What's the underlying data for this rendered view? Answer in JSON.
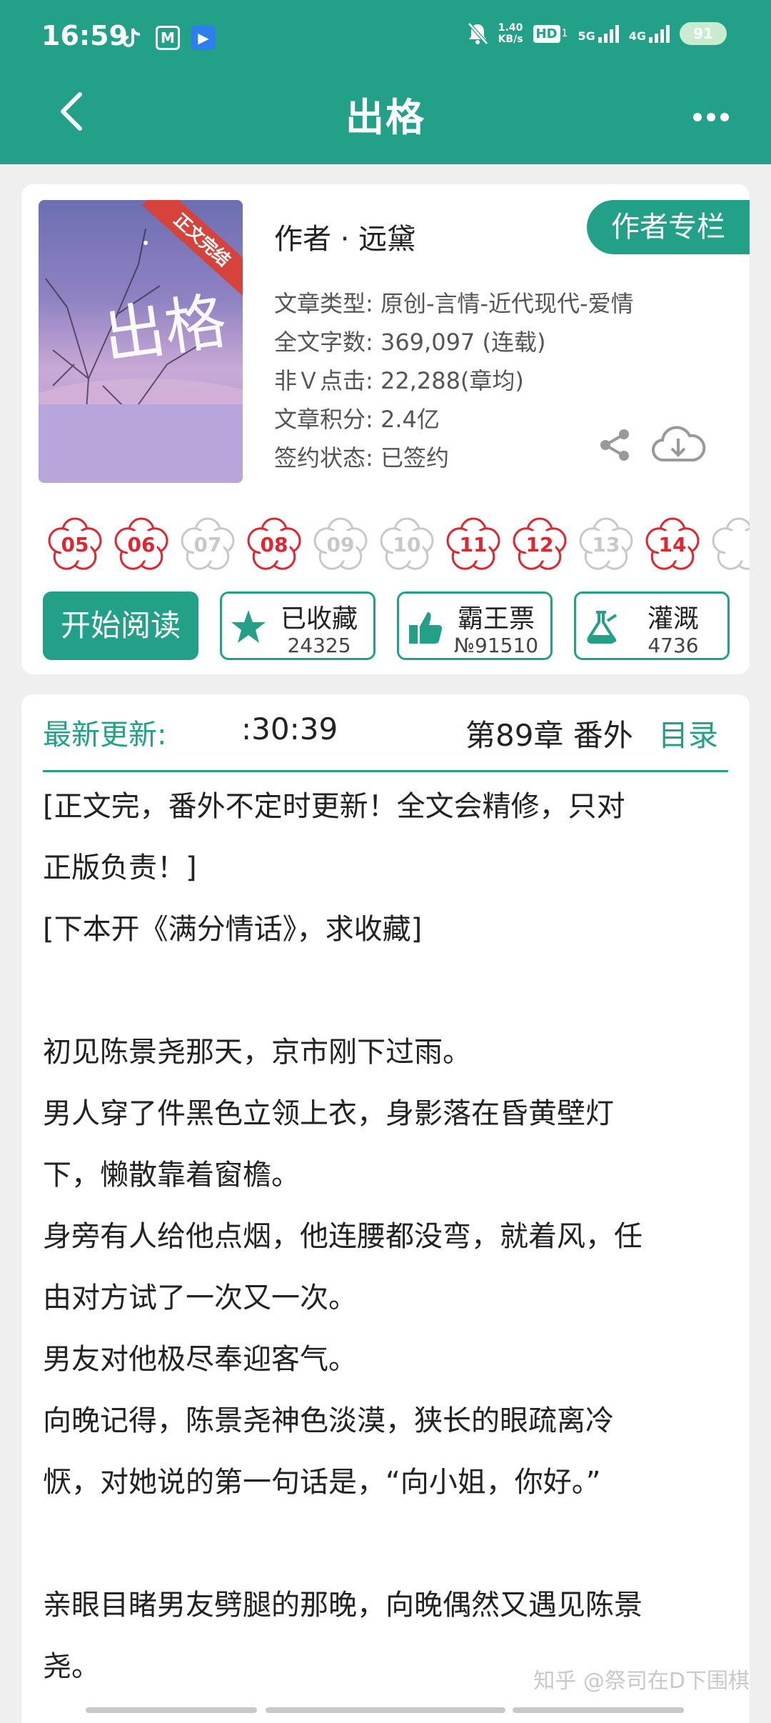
{
  "status_bar": {
    "time": "16:59",
    "net_speed_value": "1.40",
    "net_speed_unit": "KB/s",
    "hd": "HD",
    "hd_sub": "1",
    "gen_5g": "5G",
    "gen_4g": "4G",
    "battery": "91"
  },
  "nav": {
    "title": "出格",
    "back_icon": "chevron-left",
    "more_icon": "ellipsis"
  },
  "book": {
    "cover_ribbon": "正文完结",
    "cover_title": "出格",
    "author_line": "作者 · 远黛",
    "author_column_button": "作者专栏",
    "meta": [
      "文章类型: 原创-言情-近代现代-爱情",
      "全文字数: 369,097 (连载)",
      "非Ｖ点击: 22,288(章均)",
      "文章积分: 2.4亿",
      "签约状态: 已签约"
    ]
  },
  "flowers": [
    {
      "n": "05",
      "active": true
    },
    {
      "n": "06",
      "active": true
    },
    {
      "n": "07",
      "active": false
    },
    {
      "n": "08",
      "active": true
    },
    {
      "n": "09",
      "active": false
    },
    {
      "n": "10",
      "active": false
    },
    {
      "n": "11",
      "active": true
    },
    {
      "n": "12",
      "active": true
    },
    {
      "n": "13",
      "active": false
    },
    {
      "n": "14",
      "active": true
    }
  ],
  "actions": {
    "start_reading": "开始阅读",
    "collect_label": "已收藏",
    "collect_count": "24325",
    "ticket_label": "霸王票",
    "ticket_count": "№91510",
    "irrigate_label": "灌溉",
    "irrigate_count": "4736"
  },
  "update": {
    "label": "最新更新:",
    "time": ":30:39",
    "chapter": "第89章  番外",
    "toc": "目录"
  },
  "summary": [
    "[正文完，番外不定时更新！全文会精修，只对",
    "正版负责！]",
    "[下本开《满分情话》，求收藏]",
    "",
    "初见陈景尧那天，京市刚下过雨。",
    "男人穿了件黑色立领上衣，身影落在昏黄壁灯",
    "下，懒散靠着窗檐。",
    "身旁有人给他点烟，他连腰都没弯，就着风，任",
    "由对方试了一次又一次。",
    "男友对他极尽奉迎客气。",
    "向晚记得，陈景尧神色淡漠，狭长的眼疏离冷",
    "恹，对她说的第一句话是，“向小姐，你好。”",
    "",
    "亲眼目睹男友劈腿的那晚，向晚偶然又遇见陈景",
    "尧。"
  ],
  "watermark": "知乎 @祭司在D下围棋",
  "colors": {
    "accent": "#22a088",
    "flower_active": "#e0252f",
    "flower_inactive": "#c8c8c8"
  }
}
